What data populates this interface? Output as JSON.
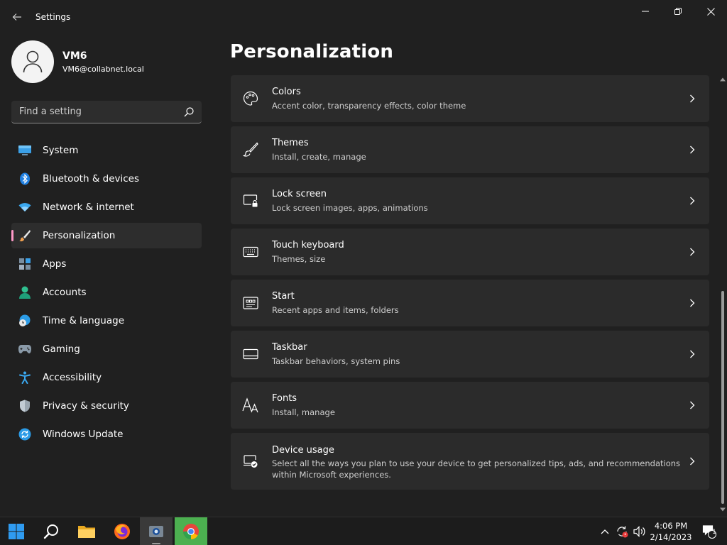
{
  "window": {
    "title": "Settings"
  },
  "profile": {
    "name": "VM6",
    "email": "VM6@collabnet.local"
  },
  "search": {
    "placeholder": "Find a setting"
  },
  "nav": {
    "items": [
      {
        "label": "System",
        "icon": "monitor-icon"
      },
      {
        "label": "Bluetooth & devices",
        "icon": "bluetooth-icon"
      },
      {
        "label": "Network & internet",
        "icon": "wifi-icon"
      },
      {
        "label": "Personalization",
        "icon": "paintbrush-icon",
        "active": true
      },
      {
        "label": "Apps",
        "icon": "apps-icon"
      },
      {
        "label": "Accounts",
        "icon": "person-icon"
      },
      {
        "label": "Time & language",
        "icon": "globe-clock-icon"
      },
      {
        "label": "Gaming",
        "icon": "gamepad-icon"
      },
      {
        "label": "Accessibility",
        "icon": "accessibility-icon"
      },
      {
        "label": "Privacy & security",
        "icon": "shield-icon"
      },
      {
        "label": "Windows Update",
        "icon": "update-icon"
      }
    ]
  },
  "page": {
    "title": "Personalization"
  },
  "cards": [
    {
      "title": "Colors",
      "desc": "Accent color, transparency effects, color theme",
      "icon": "palette-icon"
    },
    {
      "title": "Themes",
      "desc": "Install, create, manage",
      "icon": "brush-icon"
    },
    {
      "title": "Lock screen",
      "desc": "Lock screen images, apps, animations",
      "icon": "lock-screen-icon"
    },
    {
      "title": "Touch keyboard",
      "desc": "Themes, size",
      "icon": "keyboard-icon"
    },
    {
      "title": "Start",
      "desc": "Recent apps and items, folders",
      "icon": "start-icon"
    },
    {
      "title": "Taskbar",
      "desc": "Taskbar behaviors, system pins",
      "icon": "taskbar-icon"
    },
    {
      "title": "Fonts",
      "desc": "Install, manage",
      "icon": "fonts-icon"
    },
    {
      "title": "Device usage",
      "desc": "Select all the ways you plan to use your device to get personalized tips, ads, and recommendations within Microsoft experiences.",
      "icon": "device-usage-icon"
    }
  ],
  "taskbar": {
    "apps": [
      "windows-start-icon",
      "search-icon",
      "file-explorer-icon",
      "firefox-icon",
      "active-app-icon",
      "chrome-icon"
    ],
    "clock": {
      "time": "4:06 PM",
      "date": "2/14/2023"
    },
    "notification_count": "1"
  },
  "colors": {
    "accent": "#ff99c8",
    "background": "#202020",
    "card": "#2b2b2b"
  }
}
